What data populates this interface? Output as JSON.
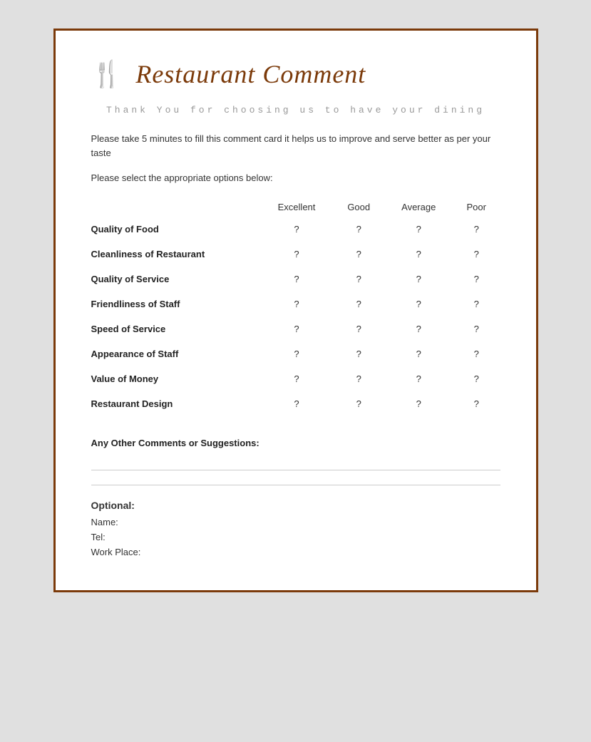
{
  "header": {
    "title": "Restaurant Comment",
    "icon": "🍴"
  },
  "thank_you_text": "Thank You for choosing us to have your\ndining",
  "description": "Please take 5 minutes to fill this comment card it helps us to improve and serve better as per your taste",
  "instruction": "Please select the appropriate options below:",
  "table": {
    "columns": [
      "",
      "Excellent",
      "Good",
      "Average",
      "Poor"
    ],
    "rows": [
      {
        "label": "Quality of Food"
      },
      {
        "label": "Cleanliness of Restaurant"
      },
      {
        "label": "Quality of Service"
      },
      {
        "label": "Friendliness of Staff"
      },
      {
        "label": "Speed of Service"
      },
      {
        "label": "Appearance of Staff"
      },
      {
        "label": "Value of Money"
      },
      {
        "label": "Restaurant Design"
      }
    ],
    "radio_symbol": "?"
  },
  "comments": {
    "label": "Any Other Comments or Suggestions:"
  },
  "optional": {
    "title": "Optional:",
    "fields": [
      "Name:",
      "Tel:",
      "Work Place:"
    ]
  }
}
